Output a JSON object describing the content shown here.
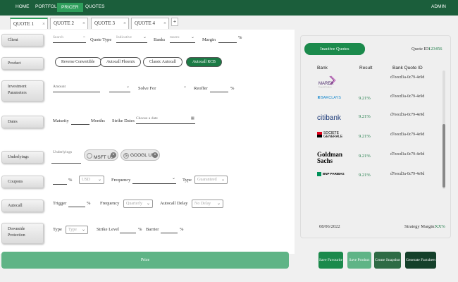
{
  "nav": {
    "items": [
      "HOME",
      "PORTFOLIO",
      "PRICER",
      "QUOTES"
    ],
    "admin": "ADMIN"
  },
  "tabs": [
    "QUOTE 1",
    "QUOTE 2",
    "QUOTE 3",
    "QUOTE 4"
  ],
  "tab_close": "×",
  "tab_add": "+",
  "labels": {
    "client": "Client",
    "product": "Product",
    "investment": "Investment Parameters",
    "dates": "Dates",
    "underlyings": "Underlyings",
    "coupons": "Coupons",
    "autocall": "Autocall",
    "downside": "Downside Protection"
  },
  "client": {
    "search_placeholder": "Search",
    "quote_type_label": "Quote Type",
    "quote_type_value": "Indicative",
    "banks_label": "Banks",
    "banks_value": "marex",
    "margin_label": "Margin",
    "percent": "%"
  },
  "products": [
    "Reverse Convertible",
    "Autocall Phoenix",
    "Classic Autocall",
    "Autocall RCB"
  ],
  "investment": {
    "amount_placeholder": "Amount",
    "solve_for_label": "Solve For",
    "reoffer_label": "Reoffer",
    "percent": "%"
  },
  "dates": {
    "maturity_label": "Maturity",
    "months_label": "Months",
    "strike_dates_label": "Strike Dates",
    "date_placeholder": "Choose a date"
  },
  "underlyings": {
    "placeholder": "Underlyings",
    "chips": [
      "MSFT US",
      "GOOGL US"
    ]
  },
  "coupons": {
    "percent": "%",
    "currency": "USD",
    "frequency_label": "Frequency",
    "type_label": "Type",
    "type_value": "Guaranteed"
  },
  "autocall": {
    "trigger_label": "Trigger",
    "percent": "%",
    "frequency_label": "Frequency",
    "frequency_value": "Quarterly",
    "delay_label": "Autocall Delay",
    "delay_value": "No Delay"
  },
  "downside": {
    "type_label": "Type",
    "type_value": "Type",
    "strike_label": "Strike Level",
    "barrier_label": "Barrier",
    "percent": "%"
  },
  "price_button": "Price",
  "quotes_panel": {
    "status": "Inactive Quotes",
    "quote_id_label": "Quote ID:",
    "quote_id": "123456",
    "headers": [
      "Bank",
      "Result",
      "Bank Quote ID"
    ],
    "rows": [
      {
        "bank": "MAREX",
        "result": "",
        "id": "d7eecd3a-0c79-4e9d"
      },
      {
        "bank": "BARCLAYS",
        "result": "9.21%",
        "id": "d7eecd3a-0c79-4e9d"
      },
      {
        "bank": "citibank",
        "result": "9.21%",
        "id": "d7eecd3a-0c79-4e9d"
      },
      {
        "bank": "SOCIETE GENERALE",
        "result": "9.21%",
        "id": "d7eecd3a-0c79-4e9d"
      },
      {
        "bank": "Goldman Sachs",
        "result": "9.21%",
        "id": "d7eecd3a-0c79-4e9d"
      },
      {
        "bank": "BNP PARIBAS",
        "result": "9.21%",
        "id": "d7eecd3a-0c79-4e9d"
      }
    ],
    "marex_sub": "Financial Products",
    "date": "08/06/2022",
    "strategy_margin_label": "Strategy Margin:",
    "strategy_margin": "XX%"
  },
  "actions": [
    "Save Favourite",
    "Save Product",
    "Create Snapshot",
    "Generate Factsheet"
  ],
  "colors": {
    "accent": "#1b7a45",
    "nav": "#1b5e3b",
    "price": "#5fb486"
  }
}
